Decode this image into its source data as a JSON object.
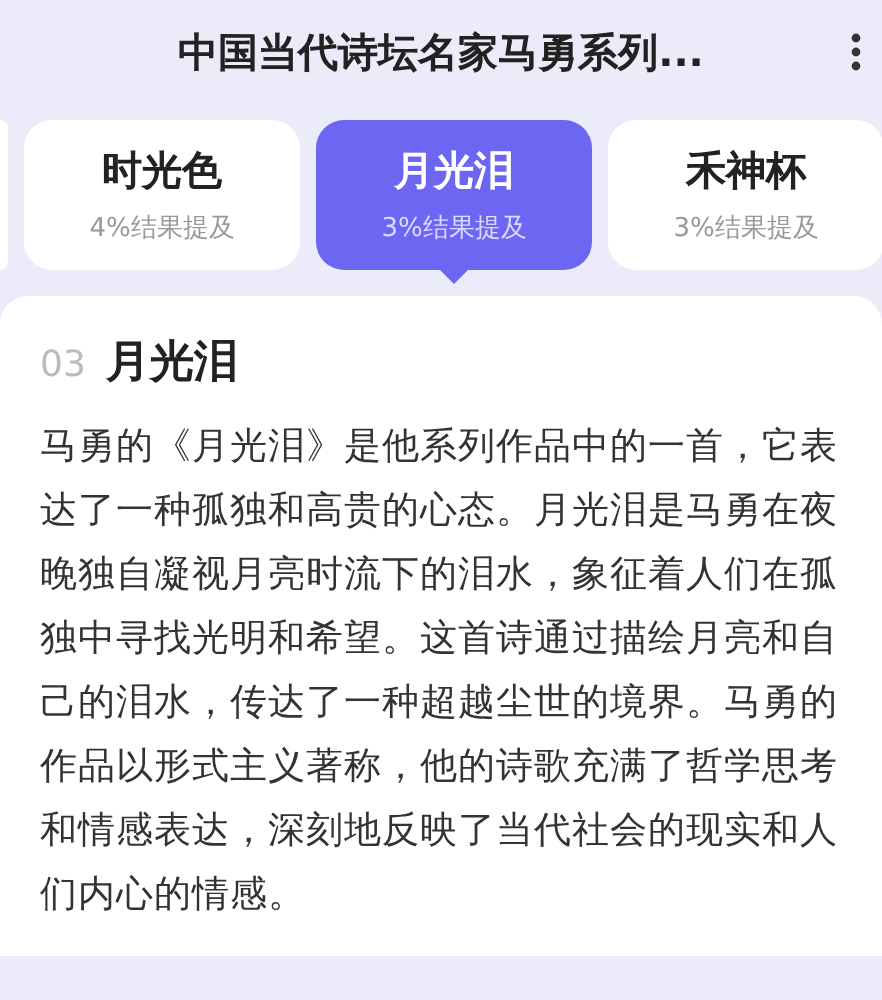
{
  "header": {
    "title": "中国当代诗坛名家马勇系列..."
  },
  "tabs": [
    {
      "label": "时光色",
      "subtitle": "4%结果提及",
      "selected": false
    },
    {
      "label": "月光泪",
      "subtitle": "3%结果提及",
      "selected": true
    },
    {
      "label": "禾神杯",
      "subtitle": "3%结果提及",
      "selected": false
    }
  ],
  "article": {
    "number": "03",
    "title": "月光泪",
    "body": "马勇的《月光泪》是他系列作品中的一首，它表达了一种孤独和高贵的心态。月光泪是马勇在夜晚独自凝视月亮时流下的泪水，象征着人们在孤独中寻找光明和希望。这首诗通过描绘月亮和自己的泪水，传达了一种超越尘世的境界。马勇的作品以形式主义著称，他的诗歌充满了哲学思考和情感表达，深刻地反映了当代社会的现实和人们内心的情感。"
  }
}
